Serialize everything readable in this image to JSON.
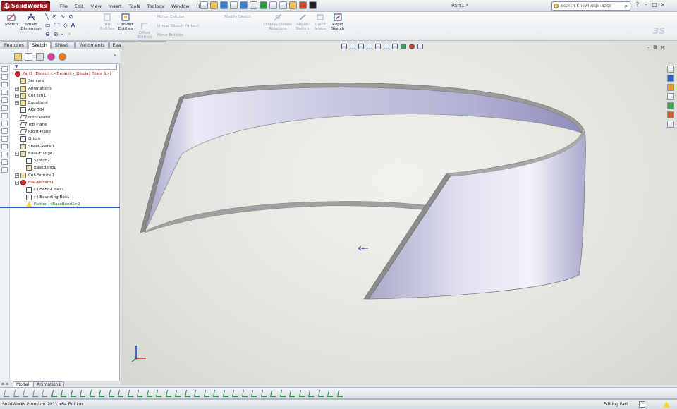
{
  "app": {
    "logo_text": "SolidWorks",
    "document_title": "Part1 *",
    "menus": [
      "File",
      "Edit",
      "View",
      "Insert",
      "Tools",
      "Toolbox",
      "Window",
      "Help"
    ],
    "search_placeholder": "Search Knowledge Base",
    "window_controls": [
      "?",
      "-",
      "□",
      "×"
    ]
  },
  "command_manager": {
    "buttons": [
      {
        "name": "sketch-button",
        "label": "Sketch",
        "enabled": true
      },
      {
        "name": "smart-dimension-button",
        "label": "Smart Dimension",
        "enabled": true
      },
      {
        "name": "trim-entities-button",
        "label": "Trim Entities",
        "enabled": false
      },
      {
        "name": "convert-entities-button",
        "label": "Convert Entities",
        "enabled": true
      },
      {
        "name": "offset-entities-button",
        "label": "Offset Entities",
        "enabled": false
      },
      {
        "name": "display-delete-relations-button",
        "label": "Display/Delete Relations",
        "enabled": false
      },
      {
        "name": "repair-sketch-button",
        "label": "Repair Sketch",
        "enabled": false
      },
      {
        "name": "quick-snaps-button",
        "label": "Quick Snaps",
        "enabled": false
      },
      {
        "name": "rapid-sketch-button",
        "label": "Rapid Sketch",
        "enabled": true
      }
    ],
    "small_buttons": [
      "Mirror Entities",
      "Linear Sketch Pattern",
      "Move Entities",
      "Modify Sketch"
    ]
  },
  "tabs": [
    {
      "label": "Features",
      "active": false
    },
    {
      "label": "Sketch",
      "active": true
    },
    {
      "label": "Sheet Metal",
      "active": false
    },
    {
      "label": "Weldments",
      "active": false
    },
    {
      "label": "Evaluate",
      "active": false
    },
    {
      "label": "DimXpert",
      "active": false
    }
  ],
  "feature_tree": [
    {
      "label": "Part1  (Default<<Default>_Display State 1>)",
      "indent": 0,
      "toggle": "",
      "icon": "part-icon",
      "color": "red"
    },
    {
      "label": "Sensors",
      "indent": 1,
      "toggle": "",
      "icon": "sensors-icon",
      "color": ""
    },
    {
      "label": "Annotations",
      "indent": 1,
      "toggle": "+",
      "icon": "annotations-icon",
      "color": ""
    },
    {
      "label": "Cut list(1)",
      "indent": 1,
      "toggle": "+",
      "icon": "cut-list-icon",
      "color": ""
    },
    {
      "label": "Equations",
      "indent": 1,
      "toggle": "+",
      "icon": "equations-icon",
      "color": ""
    },
    {
      "label": "AISI 304",
      "indent": 1,
      "toggle": "",
      "icon": "material-icon",
      "color": ""
    },
    {
      "label": "Front Plane",
      "indent": 1,
      "toggle": "",
      "icon": "plane-icon",
      "color": ""
    },
    {
      "label": "Top Plane",
      "indent": 1,
      "toggle": "",
      "icon": "plane-icon",
      "color": ""
    },
    {
      "label": "Right Plane",
      "indent": 1,
      "toggle": "",
      "icon": "plane-icon",
      "color": ""
    },
    {
      "label": "Origin",
      "indent": 1,
      "toggle": "",
      "icon": "origin-icon",
      "color": ""
    },
    {
      "label": "Sheet-Metal1",
      "indent": 1,
      "toggle": "",
      "icon": "sheet-metal-icon",
      "color": ""
    },
    {
      "label": "Base-Flange1",
      "indent": 1,
      "toggle": "-",
      "icon": "base-flange-icon",
      "color": ""
    },
    {
      "label": "Sketch2",
      "indent": 2,
      "toggle": "",
      "icon": "sketch-icon",
      "color": ""
    },
    {
      "label": "BaseBend1",
      "indent": 2,
      "toggle": "",
      "icon": "bend-icon",
      "color": ""
    },
    {
      "label": "Cut-Extrude1",
      "indent": 1,
      "toggle": "+",
      "icon": "cut-extrude-icon",
      "color": ""
    },
    {
      "label": "Flat-Pattern1",
      "indent": 1,
      "toggle": "-",
      "icon": "flat-pattern-icon",
      "color": "red"
    },
    {
      "label": "(-) Bend-Lines1",
      "indent": 2,
      "toggle": "",
      "icon": "sketch-icon",
      "color": ""
    },
    {
      "label": "(-) Bounding-Box1",
      "indent": 2,
      "toggle": "",
      "icon": "sketch-icon",
      "color": ""
    },
    {
      "label": "Flatten-<BaseBend1>1",
      "indent": 2,
      "toggle": "",
      "icon": "warning-icon",
      "color": "green"
    }
  ],
  "bottom_tabs": [
    {
      "label": "Model",
      "active": true
    },
    {
      "label": "Animation1",
      "active": false
    }
  ],
  "status": {
    "edition": "SolidWorks Premium 2011 x64 Edition",
    "mode": "Editing Part",
    "help": "?"
  },
  "colors": {
    "part_face_light": "#eeeef7",
    "part_face_mid": "#b3b3d3",
    "part_edge": "#9c9c9c",
    "accent_red": "#b41f24",
    "rollback_bar": "#2d5fb7"
  }
}
